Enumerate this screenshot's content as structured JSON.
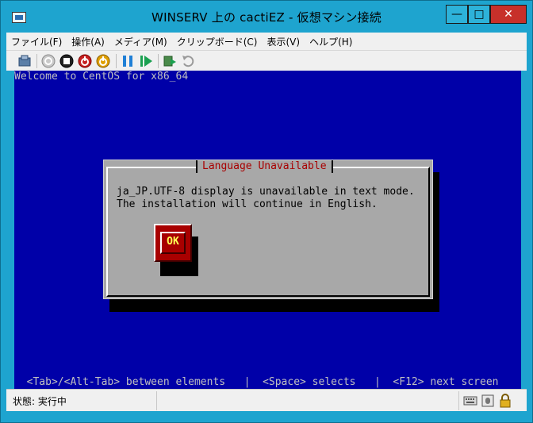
{
  "window": {
    "title": "WINSERV 上の cactiEZ  - 仮想マシン接続",
    "min_glyph": "—",
    "max_glyph": "□",
    "close_glyph": "✕"
  },
  "menu": [
    "ファイル(F)",
    "操作(A)",
    "メディア(M)",
    "クリップボード(C)",
    "表示(V)",
    "ヘルプ(H)"
  ],
  "toolbar_icons": [
    "ctrl-alt-del-icon",
    "start-icon",
    "turn-off-icon",
    "shutdown-icon",
    "save-icon",
    "pause-icon",
    "resume-icon",
    "checkpoint-icon",
    "revert-icon"
  ],
  "console": {
    "welcome": "Welcome to CentOS for x86_64",
    "dialog_title": "Language Unavailable",
    "dialog_line1": "ja_JP.UTF-8 display is unavailable in text mode.",
    "dialog_line2": "The installation will continue in English.",
    "ok_label": "OK",
    "help_line": "  <Tab>/<Alt-Tab> between elements   |  <Space> selects   |  <F12> next screen"
  },
  "status": {
    "text": "状態: 実行中"
  },
  "colors": {
    "console_bg": "#0000a8",
    "dialog_bg": "#a8a8a8",
    "dialog_title": "#a80000",
    "ok_bg": "#a80000",
    "ok_text": "#ffff55"
  }
}
